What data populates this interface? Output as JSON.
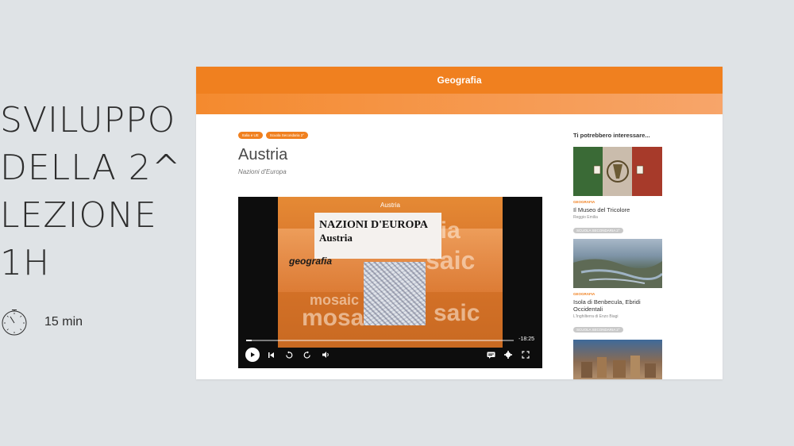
{
  "slide": {
    "title_lines": [
      "SVILUPPO",
      "DELLA 2^",
      "LEZIONE",
      "1H"
    ],
    "duration": "15 min",
    "timer_icon": "stopwatch-icon"
  },
  "screenshot": {
    "header_title": "Geografia",
    "accent_color": "#f0801f",
    "tags": [
      "Italia e UE",
      "Scuola Secondaria 2°"
    ],
    "article_title": "Austria",
    "article_subtitle": "Nazioni d'Europa",
    "video": {
      "title": "Austria",
      "frame_heading": "NAZIONI D'EUROPA",
      "frame_subheading": "Austria",
      "frame_brand": "geografia",
      "time_remaining": "-18:25",
      "progress_fraction": 0.02,
      "controls": [
        "play-icon",
        "skip-back-icon",
        "rewind-icon",
        "forward-icon",
        "volume-icon",
        "captions-icon",
        "settings-icon",
        "fullscreen-icon"
      ]
    },
    "sidebar": {
      "heading": "Ti potrebbero interessare...",
      "cards": [
        {
          "category": "GEOGRAFIA",
          "title": "Il Museo del Tricolore",
          "meta": "Reggio Emilia",
          "badge": "SCUOLA SECONDARIA 2°"
        },
        {
          "category": "GEOGRAFIA",
          "title": "Isola di Benbecula, Ebridi Occidentali",
          "meta": "L'Inghilterra di Enzo Biagi",
          "badge": "SCUOLA SECONDARIA 2°"
        }
      ]
    }
  }
}
